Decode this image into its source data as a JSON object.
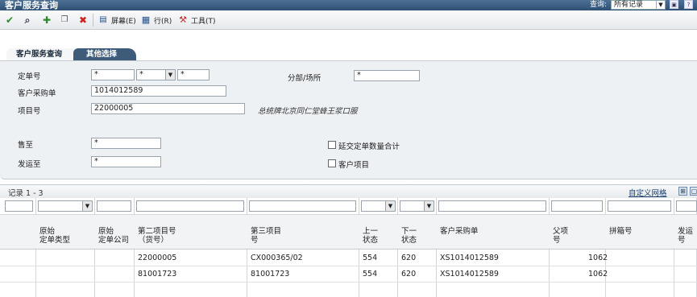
{
  "window": {
    "title": "客户服务查询",
    "query_label": "查询:",
    "query_value": "所有记录"
  },
  "toolbar": {
    "screen": "屏幕(E)",
    "row": "行(R)",
    "tools": "工具(T)"
  },
  "tabs": [
    {
      "label": "客户服务查询"
    },
    {
      "label": "其他选择"
    }
  ],
  "form": {
    "order_no_label": "定单号",
    "order_no_1": "*",
    "order_no_2": "*",
    "order_no_3": "*",
    "branch_label": "分部/场所",
    "branch_value": "*",
    "customer_po_label": "客户采购单",
    "customer_po_value": "1014012589",
    "item_no_label": "项目号",
    "item_no_value": "22000005",
    "item_desc": "总统牌北京同仁堂蜂王浆口服",
    "sold_to_label": "售至",
    "sold_to_value": "*",
    "ship_to_label": "发运至",
    "ship_to_value": "*",
    "chk_backorder_label": "延交定单数量合计",
    "chk_customer_item_label": "客户项目"
  },
  "grid": {
    "records": "记录 1 - 3",
    "customize": "自定义网格",
    "columns": [
      {
        "label": ""
      },
      {
        "label": "原始\n定单类型"
      },
      {
        "label": "原始\n定单公司"
      },
      {
        "label": "第二项目号\n（货号）"
      },
      {
        "label": "第三项目\n号"
      },
      {
        "label": "上一\n状态"
      },
      {
        "label": "下一\n状态"
      },
      {
        "label": "客户采购单"
      },
      {
        "label": "父项\n号"
      },
      {
        "label": "拼箱号"
      },
      {
        "label": "发运\n号"
      }
    ],
    "rows": [
      {
        "item2": "22000005",
        "item3": "CX000365/02",
        "last": "554",
        "next": "620",
        "po": "XS1014012589",
        "parent": "1062"
      },
      {
        "item2": "81001723",
        "item3": "81001723",
        "last": "554",
        "next": "620",
        "po": "XS1014012589",
        "parent": "1062"
      }
    ]
  },
  "colors": {
    "titlebar": "#2f5075",
    "active_tab": "#3e5c7a",
    "confirm": "#2a8a2a",
    "delete": "#cc2222",
    "link": "#1a3d6e"
  }
}
